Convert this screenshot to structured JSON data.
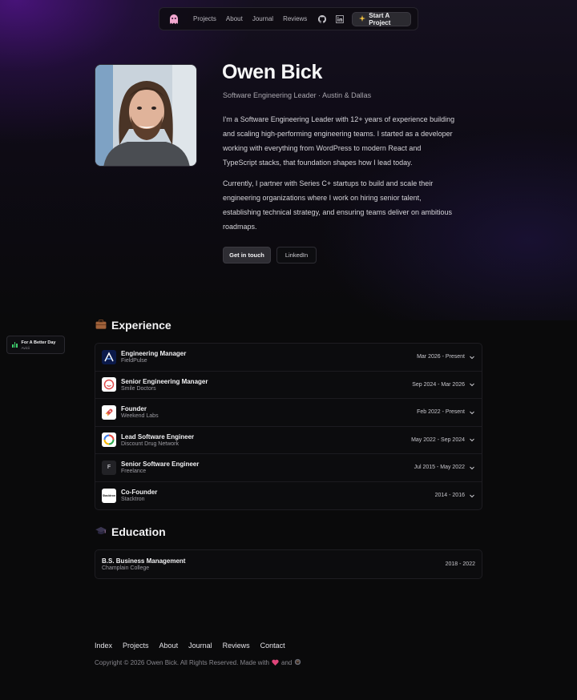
{
  "nav": {
    "links": [
      "Projects",
      "About",
      "Journal",
      "Reviews"
    ],
    "cta_label": "Start A Project",
    "icons": [
      "ghost-logo-icon",
      "github-icon",
      "linkedin-icon",
      "sparkle-icon"
    ]
  },
  "hero": {
    "name": "Owen Bick",
    "subtitle": "Software Engineering Leader · Austin & Dallas",
    "paragraph1": "I'm a Software Engineering Leader with 12+ years of experience building and scaling high-performing engineering teams. I started as a developer working with everything from WordPress to modern React and TypeScript stacks, that foundation shapes how I lead today.",
    "paragraph2": "Currently, I partner with Series C+ startups to build and scale their engineering organizations where I work on hiring senior talent, establishing technical strategy, and ensuring teams deliver on ambitious roadmaps.",
    "primary_button": "Get in touch",
    "secondary_button": "LinkedIn"
  },
  "badge": {
    "title": "For A Better Day",
    "artist": "Avicii"
  },
  "experience": {
    "title": "Experience",
    "items": [
      {
        "role": "Engineering Manager",
        "company": "FieldPulse",
        "dates": "Mar 2026 - Present",
        "logo": "fieldpulse-logo-icon"
      },
      {
        "role": "Senior Engineering Manager",
        "company": "Smile Doctors",
        "dates": "Sep 2024 - Mar 2026",
        "logo": "smile-doctors-logo-icon"
      },
      {
        "role": "Founder",
        "company": "Weekend Labs",
        "dates": "Feb 2022 - Present",
        "logo": "rocket-icon"
      },
      {
        "role": "Lead Software Engineer",
        "company": "Discount Drug Network",
        "dates": "May 2022 - Sep 2024",
        "logo": "ddn-logo-icon"
      },
      {
        "role": "Senior Software Engineer",
        "company": "Freelance",
        "dates": "Jul 2015 - May 2022",
        "logo": "freelance-logo-icon",
        "logo_text": "F"
      },
      {
        "role": "Co-Founder",
        "company": "Stacktron",
        "dates": "2014 - 2016",
        "logo": "stacktron-logo-icon",
        "logo_text": "Stacktron"
      }
    ]
  },
  "education": {
    "title": "Education",
    "items": [
      {
        "degree": "B.S. Business Management",
        "school": "Champlain College",
        "dates": "2018 - 2022"
      }
    ]
  },
  "footer": {
    "links": [
      "Index",
      "Projects",
      "About",
      "Journal",
      "Reviews",
      "Contact"
    ],
    "copyright": "Copyright © 2026 Owen Bick. All Rights Reserved. Made with",
    "and": "and"
  },
  "colors": {
    "background": "#0a0a0b",
    "accent_purple": "#5a1496",
    "heart": "#e0457a",
    "badge_green": "#3ecf6e"
  }
}
